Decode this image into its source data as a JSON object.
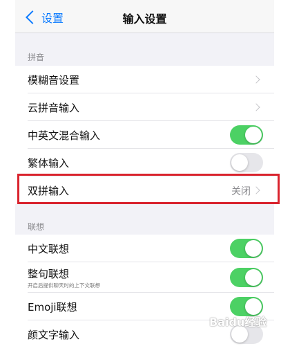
{
  "nav": {
    "back_label": "设置",
    "title": "输入设置"
  },
  "sections": {
    "pinyin": "拼音",
    "association": "联想"
  },
  "pinyin_rows": [
    {
      "label": "模糊音设置",
      "type": "chevron"
    },
    {
      "label": "云拼音输入",
      "type": "chevron"
    },
    {
      "label": "中英文混合输入",
      "type": "toggle",
      "on": true
    },
    {
      "label": "繁体输入",
      "type": "toggle",
      "on": false
    },
    {
      "label": "双拼输入",
      "type": "value",
      "value": "关闭"
    }
  ],
  "association_rows": [
    {
      "label": "中文联想",
      "type": "toggle",
      "on": true
    },
    {
      "label": "整句联想",
      "subtitle": "开启后提供聊天时的上下文联想",
      "type": "toggle",
      "on": true
    },
    {
      "label": "Emoji联想",
      "type": "toggle",
      "on": true
    },
    {
      "label": "颜文字输入",
      "type": "toggle",
      "on": false
    }
  ],
  "watermark": "Baidu经验",
  "colors": {
    "accent": "#0a7aff",
    "toggle_on": "#4cd164",
    "highlight": "#d9232d"
  }
}
